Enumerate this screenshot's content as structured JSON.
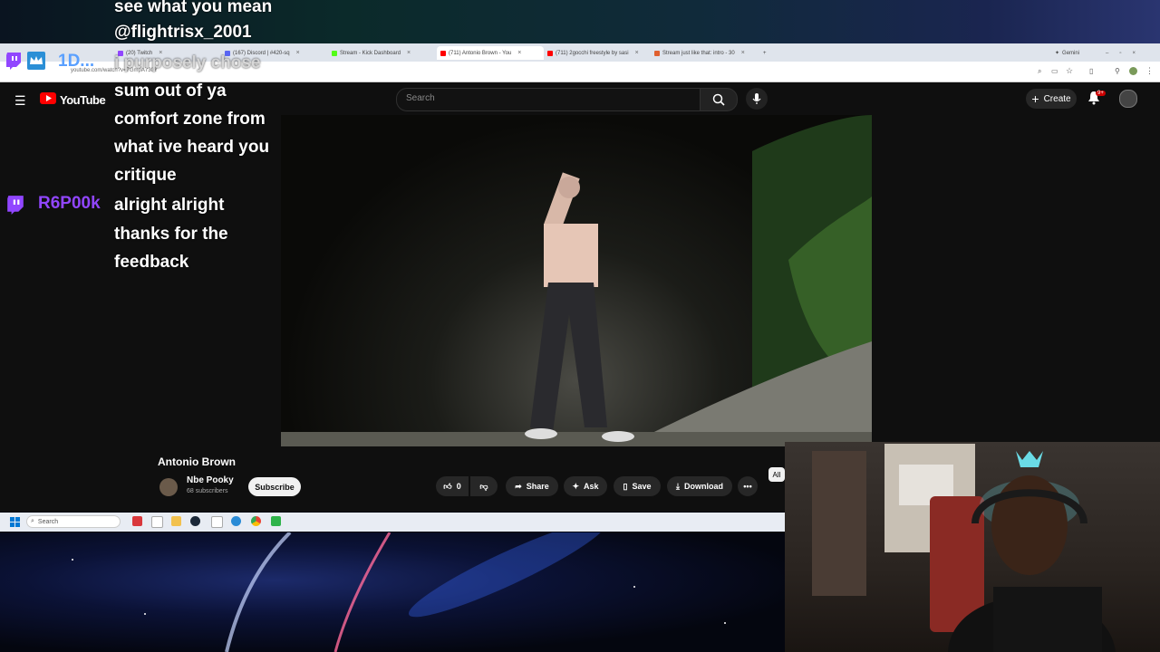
{
  "browser": {
    "tabs": [
      {
        "label": "(20) Twitch",
        "color": "#9146ff"
      },
      {
        "label": "(167) Discord | #420-sq",
        "color": "#5865f2"
      },
      {
        "label": "Stream - Kick Dashboard",
        "color": "#53fc18"
      },
      {
        "label": "(711) Antonio Brown - You",
        "color": "#ff0000"
      },
      {
        "label": "(711) 2gocchi freestyle by sasi",
        "color": "#ff0000"
      },
      {
        "label": "Stream just like that: intro - 30",
        "color": "#e06030"
      }
    ],
    "new_tab": "+",
    "gemini_label": "Gemini",
    "url": "youtube.com/watch?v=7GmpA730Y"
  },
  "youtube": {
    "logo_text": "YouTube",
    "search_placeholder": "Search",
    "create_label": "Create",
    "notification_count": "9+",
    "video_title": "Antonio Brown",
    "channel_name": "Nbe Pooky",
    "channel_subs": "68 subscribers",
    "subscribe_label": "Subscribe",
    "like_count": "0",
    "share_label": "Share",
    "ask_label": "Ask",
    "save_label": "Save",
    "download_label": "Download",
    "chip_all": "All"
  },
  "chat": {
    "messages": [
      {
        "text": "see what you mean"
      },
      {
        "text": "@flightrisx_2001"
      },
      {
        "text": "i purposely chose"
      },
      {
        "text": "sum out of ya"
      },
      {
        "text": "comfort zone from"
      },
      {
        "text": "what ive heard you"
      },
      {
        "text": "critique"
      },
      {
        "text": "alright alright"
      },
      {
        "text": "thanks for the"
      },
      {
        "text": "feedback"
      }
    ],
    "user_1": "1D...",
    "user_2": "R6P00k"
  },
  "taskbar": {
    "search_label": "Search"
  }
}
